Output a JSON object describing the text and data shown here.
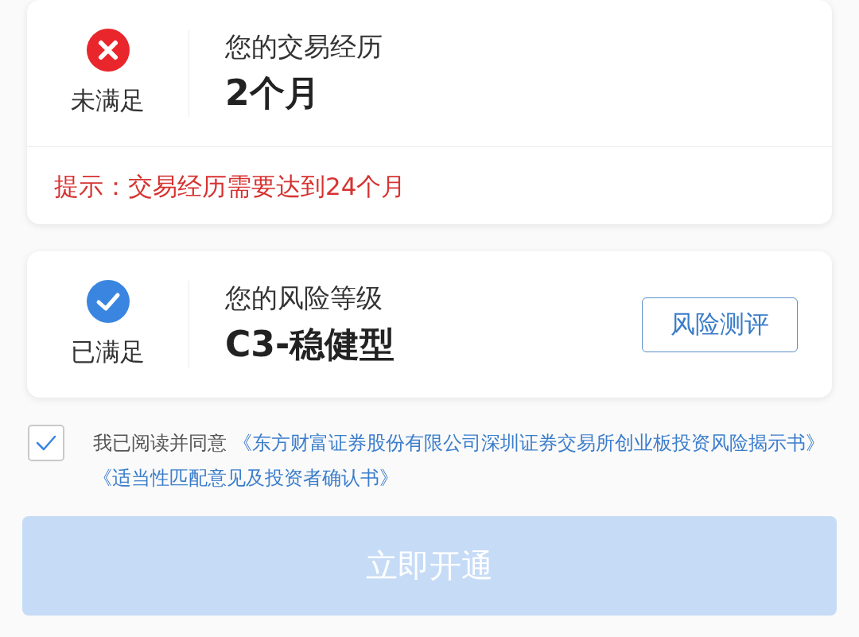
{
  "requirements": [
    {
      "satisfied": false,
      "status_label": "未满足",
      "title": "您的交易经历",
      "value": "2个月",
      "hint": "提示：交易经历需要达到24个月"
    },
    {
      "satisfied": true,
      "status_label": "已满足",
      "title": "您的风险等级",
      "value": "C3-稳健型",
      "action": "风险测评"
    }
  ],
  "agreement": {
    "checked": true,
    "prefix": "我已阅读并同意",
    "links": [
      "《东方财富证券股份有限公司深圳证券交易所创业板投资风险揭示书》",
      "《适当性匹配意见及投资者确认书》"
    ]
  },
  "submit": {
    "label": "立即开通",
    "disabled": true
  }
}
